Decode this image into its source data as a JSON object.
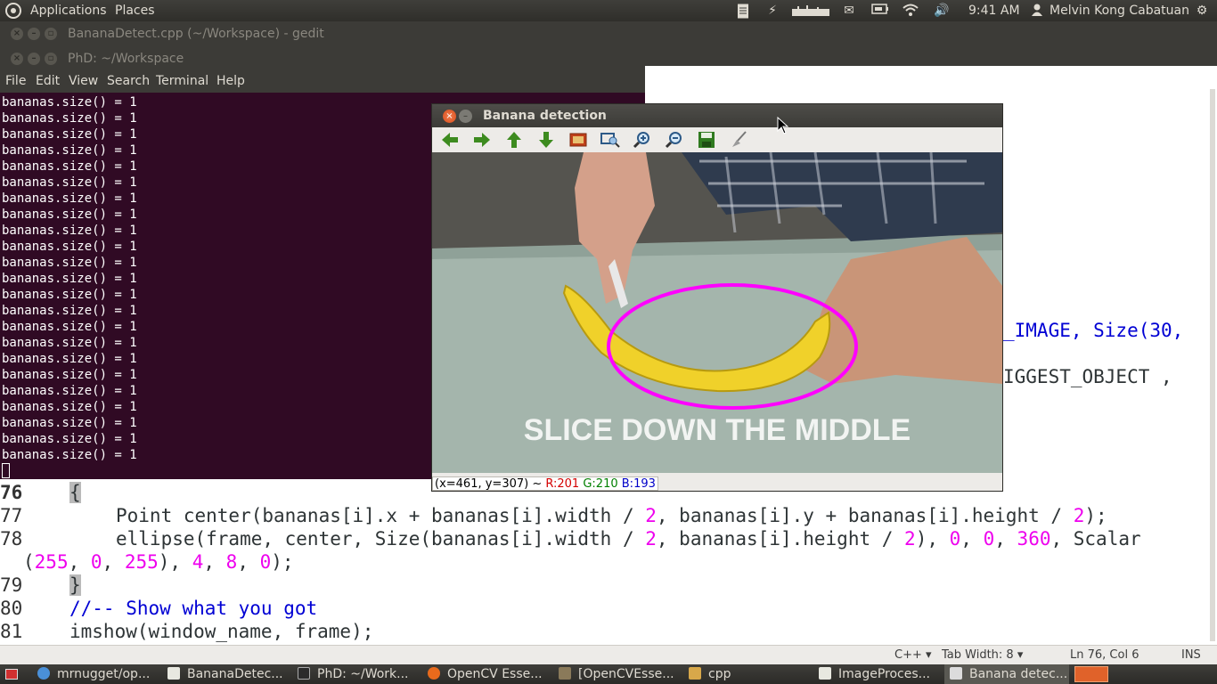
{
  "top_panel": {
    "applications": "Applications",
    "places": "Places",
    "clock": "9:41 AM",
    "user": "Melvin Kong Cabatuan",
    "tray_icons": [
      "document-icon",
      "power-icon",
      "network-bars-icon",
      "mail-icon",
      "battery-icon",
      "wifi-icon",
      "volume-icon",
      "user-icon",
      "gear-icon"
    ]
  },
  "gedit": {
    "title": "BananaDetect.cpp (~/Workspace) - gedit",
    "partial_right_1": "_IMAGE, Size(30,",
    "partial_right_2": "IGGEST_OBJECT ,",
    "lines": [
      {
        "no": "76",
        "brace": "{"
      },
      {
        "no": "77",
        "text": "Point center(bananas[i].x + bananas[i].width / ",
        "n1": "2",
        "text2": ", bananas[i].y + bananas[i].height / ",
        "n2": "2",
        "text3": ");"
      },
      {
        "no": "78",
        "text": "ellipse(frame, center, Size(bananas[i].width / ",
        "n1": "2",
        "text2": ", bananas[i].height / ",
        "n2": "2",
        "text3": "), ",
        "n3": "0",
        "text4": ", ",
        "n4": "0",
        "text5": ", ",
        "n5": "360",
        "text6": ", Scalar"
      },
      {
        "cont1": "(",
        "n1": "255",
        "t1": ", ",
        "n2": "0",
        "t2": ", ",
        "n3": "255",
        "t3": "), ",
        "n4": "4",
        "t4": ", ",
        "n5": "8",
        "t5": ", ",
        "n6": "0",
        "t6": ");"
      },
      {
        "no": "79",
        "brace": "}"
      },
      {
        "no": "80",
        "comment": "//-- Show what you got"
      },
      {
        "no": "81",
        "text": "imshow(window_name, frame);"
      }
    ],
    "status": {
      "language": "C++ ▾",
      "tab_width": "Tab Width: 8 ▾",
      "position": "Ln 76, Col 6",
      "mode": "INS"
    }
  },
  "terminal": {
    "title": "PhD: ~/Workspace",
    "menu": [
      "File",
      "Edit",
      "View",
      "Search",
      "Terminal",
      "Help"
    ],
    "line_text": "bananas.size() = 1",
    "line_count": 23
  },
  "banana_window": {
    "title": "Banana detection",
    "toolbar_icons": [
      "arrow-left-icon",
      "arrow-right-icon",
      "arrow-up-icon",
      "arrow-down-icon",
      "image-icon",
      "zoom-fit-icon",
      "zoom-in-icon",
      "zoom-out-icon",
      "save-icon",
      "properties-brush-icon"
    ],
    "caption": "SLICE DOWN THE MIDDLE",
    "status_coords": "(x=461, y=307) ~ ",
    "status_r": "R:201",
    "status_g": "G:210",
    "status_b": "B:193"
  },
  "taskbar": {
    "items": [
      {
        "label": "mrnugget/op...",
        "icon": "chrome-icon"
      },
      {
        "label": "BananaDetec...",
        "icon": "gedit-icon"
      },
      {
        "label": "PhD: ~/Work...",
        "icon": "terminal-icon"
      },
      {
        "label": "OpenCV Esse...",
        "icon": "firefox-icon"
      },
      {
        "label": "[OpenCVEsse...",
        "icon": "archive-icon"
      },
      {
        "label": "cpp",
        "icon": "folder-icon"
      },
      {
        "label": "ImageProces...",
        "icon": "gedit-icon"
      },
      {
        "label": "Banana detec...",
        "icon": "window-icon"
      }
    ]
  },
  "colors": {
    "terminal_bg": "#300a24",
    "ellipse": "#ff00ff",
    "keyword_blue": "#0000d4",
    "number_magenta": "#ee00ee"
  }
}
